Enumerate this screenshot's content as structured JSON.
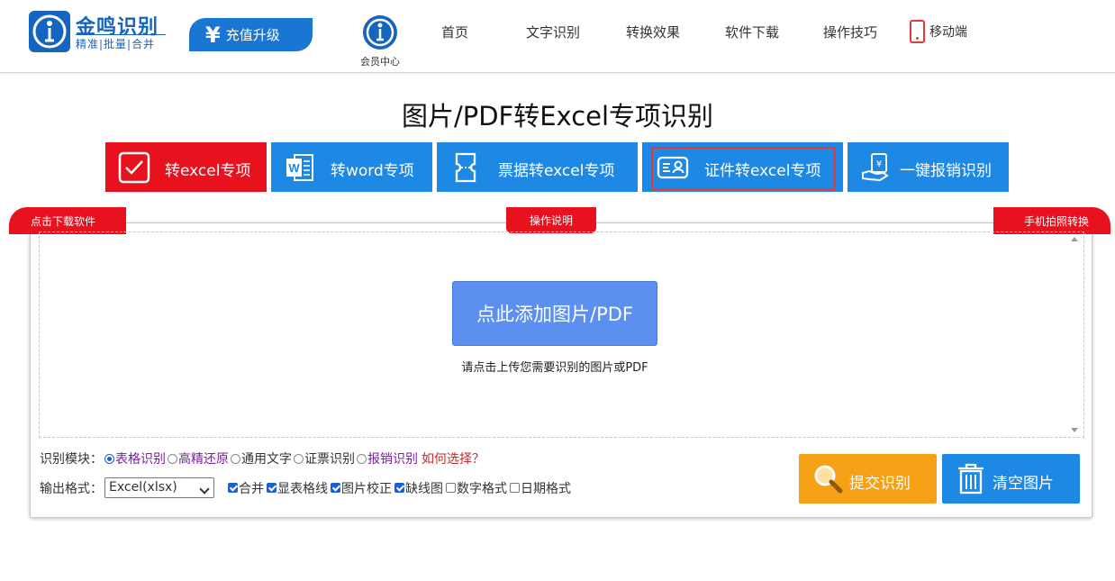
{
  "header": {
    "logo": {
      "name": "金鸣识别",
      "tagline": "精准|批量|合并"
    },
    "recharge_label": "充值升级",
    "member_label": "会员中心",
    "nav": [
      "首页",
      "文字识别",
      "转换效果",
      "软件下载",
      "操作技巧"
    ],
    "mobile_label": "移动端"
  },
  "page_title": "图片/PDF转Excel专项识别",
  "tabs": [
    {
      "label": "转excel专项"
    },
    {
      "label": "转word专项"
    },
    {
      "label": "票据转excel专项"
    },
    {
      "label": "证件转excel专项"
    },
    {
      "label": "一键报销识别"
    }
  ],
  "ribbons": {
    "left": "点击下载软件",
    "mid": "操作说明",
    "right": "手机拍照转换"
  },
  "upload": {
    "button_label": "点此添加图片/PDF",
    "hint": "请点击上传您需要识别的图片或PDF"
  },
  "options": {
    "module_label": "识别模块：",
    "modules": [
      "表格识别",
      "高精还原",
      "通用文字",
      "证票识别",
      "报销识别"
    ],
    "selected_module": "表格识别",
    "how_to_choose": "如何选择？",
    "format_label": "输出格式：",
    "format_value": "Excel(xlsx)",
    "checks": [
      {
        "label": "合并",
        "checked": true
      },
      {
        "label": "显表格线",
        "checked": true
      },
      {
        "label": "图片校正",
        "checked": true
      },
      {
        "label": "缺线图",
        "checked": true
      },
      {
        "label": "数字格式",
        "checked": false
      },
      {
        "label": "日期格式",
        "checked": false
      }
    ]
  },
  "actions": {
    "submit_label": "提交识别",
    "clear_label": "清空图片"
  },
  "colors": {
    "brand_blue": "#1e88e5",
    "active_red": "#e8121e",
    "submit_orange": "#f5a015"
  }
}
